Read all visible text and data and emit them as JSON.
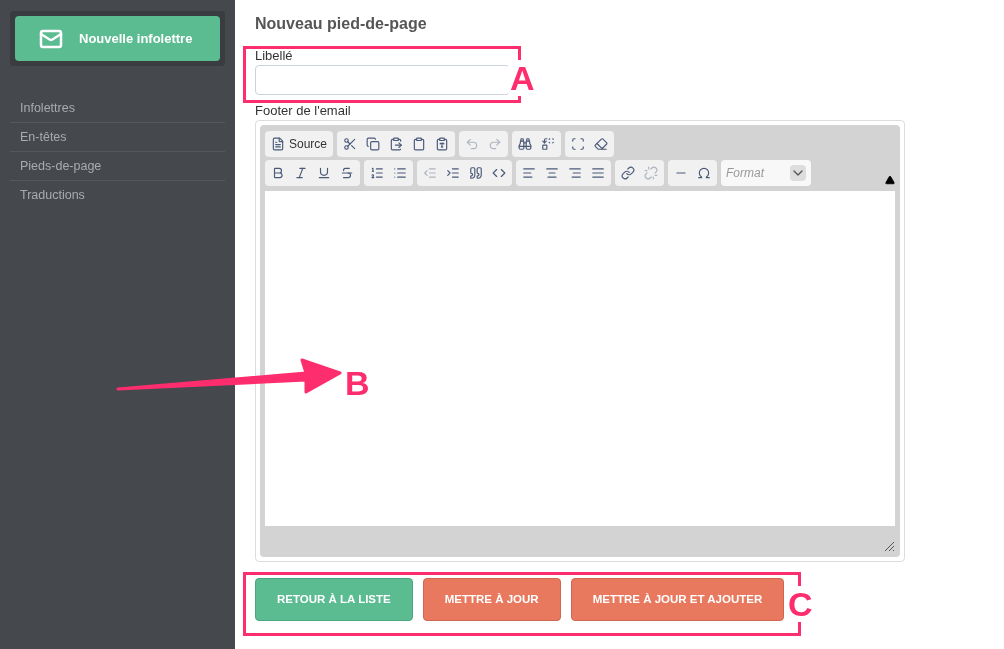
{
  "sidebar": {
    "new_button": "Nouvelle infolettre",
    "items": [
      {
        "label": "Infolettres",
        "selected": false
      },
      {
        "label": "En-têtes",
        "selected": false
      },
      {
        "label": "Pieds-de-page",
        "selected": false
      },
      {
        "label": "Traductions",
        "selected": false
      }
    ]
  },
  "title": "Nouveau pied-de-page",
  "fields": {
    "label_field": {
      "label": "Libellé"
    },
    "editor_label": "Footer de l'email"
  },
  "toolbar": {
    "rows": [
      [
        [
          {
            "label": "Source",
            "disabled": false
          }
        ],
        [
          {
            "disabled": false
          },
          {
            "disabled": false
          },
          {
            "disabled": false
          },
          {
            "disabled": false
          },
          {
            "disabled": false
          }
        ],
        [
          {
            "disabled": true
          },
          {
            "disabled": true
          }
        ],
        [
          {
            "disabled": false
          },
          {
            "disabled": false
          }
        ],
        [
          {
            "disabled": false
          },
          {
            "disabled": false
          }
        ]
      ],
      [
        [
          {
            "disabled": false
          },
          {
            "disabled": false
          },
          {
            "disabled": false
          },
          {
            "disabled": false
          }
        ],
        [
          {
            "disabled": false
          },
          {
            "disabled": false
          }
        ],
        [
          {
            "disabled": true
          },
          {
            "disabled": false
          },
          {
            "disabled": false
          },
          {
            "disabled": false
          }
        ],
        [
          {
            "disabled": false
          },
          {
            "disabled": false
          },
          {
            "disabled": false
          },
          {
            "disabled": false
          }
        ],
        [
          {
            "disabled": false
          },
          {
            "disabled": true
          }
        ],
        [
          {
            "disabled": false
          },
          {
            "disabled": false
          }
        ]
      ]
    ],
    "format_placeholder": "Format"
  },
  "buttons": [
    {
      "label": "RETOUR À LA LISTE",
      "kind": "secondary"
    },
    {
      "label": "METTRE À JOUR",
      "kind": "primary"
    },
    {
      "label": "METTRE À JOUR ET AJOUTER",
      "kind": "primary"
    }
  ],
  "annotations": [
    "A",
    "B",
    "C"
  ]
}
